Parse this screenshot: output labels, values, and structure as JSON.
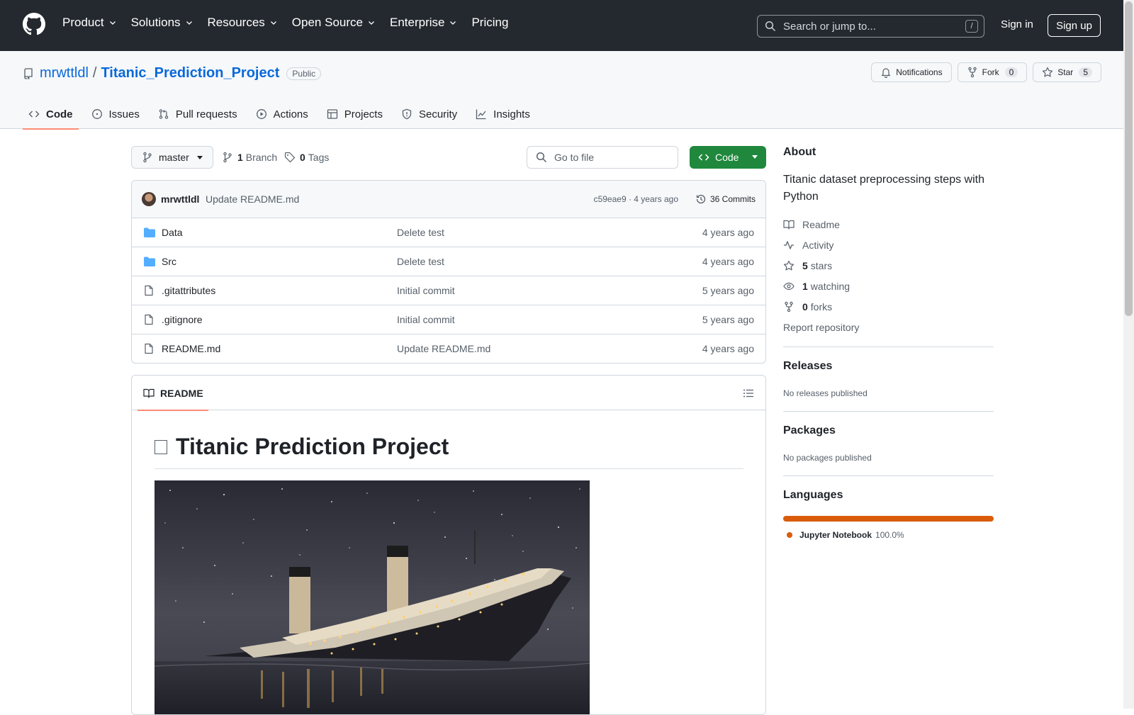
{
  "header": {
    "nav": [
      {
        "label": "Product",
        "dropdown": true
      },
      {
        "label": "Solutions",
        "dropdown": true
      },
      {
        "label": "Resources",
        "dropdown": true
      },
      {
        "label": "Open Source",
        "dropdown": true
      },
      {
        "label": "Enterprise",
        "dropdown": true
      },
      {
        "label": "Pricing",
        "dropdown": false
      }
    ],
    "search_placeholder": "Search or jump to...",
    "search_key": "/",
    "sign_in": "Sign in",
    "sign_up": "Sign up"
  },
  "repo": {
    "owner": "mrwttldl",
    "separator": "/",
    "name": "Titanic_Prediction_Project",
    "visibility": "Public",
    "notifications_label": "Notifications",
    "fork_label": "Fork",
    "fork_count": "0",
    "star_label": "Star",
    "star_count": "5",
    "tabs": [
      {
        "label": "Code",
        "icon": "code-icon",
        "active": true
      },
      {
        "label": "Issues",
        "icon": "issue-icon"
      },
      {
        "label": "Pull requests",
        "icon": "pull-request-icon"
      },
      {
        "label": "Actions",
        "icon": "play-icon"
      },
      {
        "label": "Projects",
        "icon": "table-icon"
      },
      {
        "label": "Security",
        "icon": "shield-icon"
      },
      {
        "label": "Insights",
        "icon": "graph-icon"
      }
    ]
  },
  "file_nav": {
    "branch": "master",
    "branch_count": "1",
    "branch_label": "Branch",
    "tag_count": "0",
    "tag_label": "Tags",
    "goto_placeholder": "Go to file",
    "code_button": "Code"
  },
  "latest_commit": {
    "author": "mrwttldl",
    "message": "Update README.md",
    "hash_age": "c59eae9 · 4 years ago",
    "commits": "36 Commits"
  },
  "files": [
    {
      "type": "folder",
      "name": "Data",
      "message": "Delete test",
      "age": "4 years ago"
    },
    {
      "type": "folder",
      "name": "Src",
      "message": "Delete test",
      "age": "4 years ago"
    },
    {
      "type": "file",
      "name": ".gitattributes",
      "message": "Initial commit",
      "age": "5 years ago"
    },
    {
      "type": "file",
      "name": ".gitignore",
      "message": "Initial commit",
      "age": "5 years ago"
    },
    {
      "type": "file",
      "name": "README.md",
      "message": "Update README.md",
      "age": "4 years ago"
    }
  ],
  "readme": {
    "tab_label": "README",
    "title": "Titanic Prediction Project"
  },
  "about": {
    "heading": "About",
    "description": "Titanic dataset preprocessing steps with Python",
    "readme": "Readme",
    "activity": "Activity",
    "stars_count": "5",
    "stars_label": "stars",
    "watching_count": "1",
    "watching_label": "watching",
    "forks_count": "0",
    "forks_label": "forks",
    "report": "Report repository"
  },
  "releases": {
    "heading": "Releases",
    "empty": "No releases published"
  },
  "packages": {
    "heading": "Packages",
    "empty": "No packages published"
  },
  "languages": {
    "heading": "Languages",
    "items": [
      {
        "name": "Jupyter Notebook",
        "percent": "100.0%",
        "color": "#da5b0b"
      }
    ]
  },
  "colors": {
    "header_bg": "#24292f",
    "link": "#0969da",
    "primary_button": "#1f883d",
    "active_tab_underline": "#fd8c73",
    "folder": "#54aeff"
  }
}
